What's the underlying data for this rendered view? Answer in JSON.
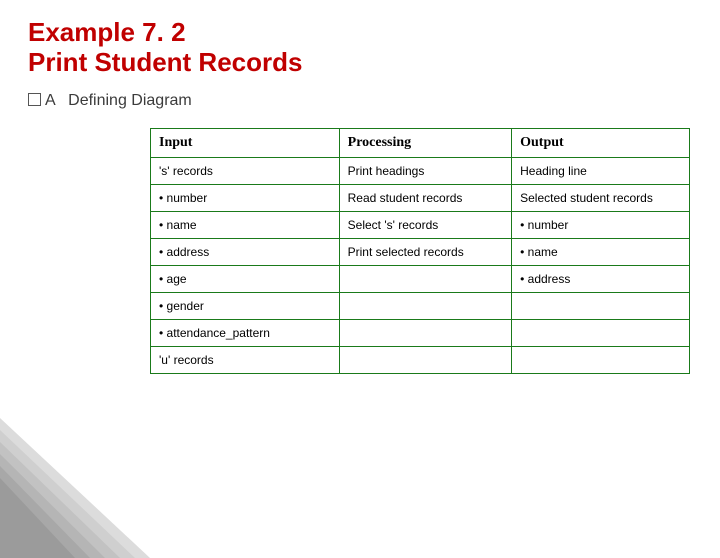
{
  "title_line1": "Example 7. 2",
  "title_line2": "Print Student Records",
  "sub_prefix": "A",
  "sub_text": "Defining Diagram",
  "headers": {
    "c0": "Input",
    "c1": "Processing",
    "c2": "Output"
  },
  "rows": [
    {
      "c0": "'s' records",
      "c1": "Print headings",
      "c2": "Heading line"
    },
    {
      "c0": "•  number",
      "c1": "Read student records",
      "c2": "Selected student records"
    },
    {
      "c0": "•  name",
      "c1": "Select 's' records",
      "c2": "•  number"
    },
    {
      "c0": "•  address",
      "c1": "Print selected records",
      "c2": "•  name"
    },
    {
      "c0": "•  age",
      "c1": "",
      "c2": "•  address"
    },
    {
      "c0": "•  gender",
      "c1": "",
      "c2": ""
    },
    {
      "c0": "•  attendance_pattern",
      "c1": "",
      "c2": ""
    },
    {
      "c0": "'u' records",
      "c1": "",
      "c2": ""
    }
  ]
}
